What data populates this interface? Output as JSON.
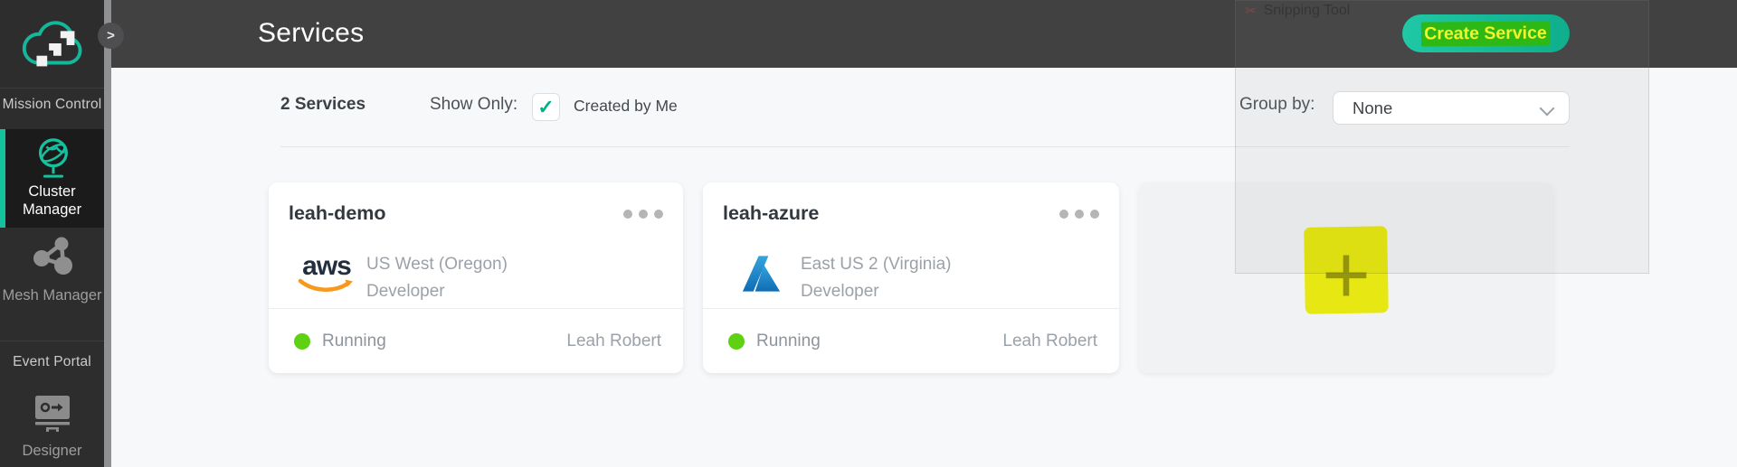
{
  "sidebar": {
    "collapse_icon": ">",
    "sections": [
      {
        "label": "Mission Control",
        "items": [
          {
            "label": "Cluster Manager",
            "icon": "globe-icon",
            "active": true
          },
          {
            "label": "Mesh Manager",
            "icon": "mesh-nodes-icon",
            "active": false
          }
        ]
      },
      {
        "label": "Event Portal",
        "items": [
          {
            "label": "Designer",
            "icon": "designer-board-icon",
            "active": false
          }
        ]
      }
    ]
  },
  "header": {
    "title": "Services",
    "create_button_label": "Create Service"
  },
  "toolbar": {
    "count_label": "2 Services",
    "show_only_label": "Show Only:",
    "created_by_me_label": "Created by Me",
    "created_by_me_checked": true,
    "check_glyph": "✓",
    "group_by_label": "Group by:",
    "group_by_value": "None"
  },
  "services": [
    {
      "name": "leah-demo",
      "provider": "AWS",
      "provider_icon": "aws-logo",
      "region": "US West (Oregon)",
      "service_class": "Developer",
      "status": "Running",
      "owner": "Leah Robert"
    },
    {
      "name": "leah-azure",
      "provider": "Azure",
      "provider_icon": "azure-logo",
      "region": "East US 2 (Virginia)",
      "service_class": "Developer",
      "status": "Running",
      "owner": "Leah Robert"
    }
  ],
  "add_service_card": {
    "plus_glyph": "+"
  },
  "ghost_window": {
    "title": "Snipping Tool",
    "scissors_glyph": "✂"
  },
  "colors": {
    "accent_teal": "#16c19d",
    "header_bg": "#414141",
    "sidebar_bg": "#2d2d2e",
    "status_green": "#5ed112",
    "highlight_yellow": "#f5f513",
    "marker_green": "#2eb816",
    "marker_text_yellow": "#f2f52b",
    "aws_orange": "#f7981f",
    "azure_blue": "#1f7fc4"
  }
}
